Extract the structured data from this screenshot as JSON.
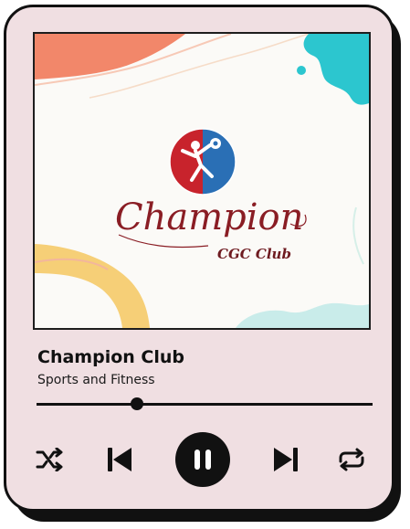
{
  "player": {
    "track_title": "Champion Club",
    "track_artist": "Sports and Fitness",
    "progress": 0.3,
    "state": "playing"
  },
  "artwork": {
    "logo_word": "Champion",
    "logo_sub": "CGC Club"
  },
  "controls": {
    "shuffle": "shuffle-icon",
    "previous": "skip-previous-icon",
    "play_pause": "pause-icon",
    "next": "skip-next-icon",
    "repeat": "repeat-icon"
  },
  "colors": {
    "card_background": "#f0dfe2",
    "outline": "#111111",
    "logo_red": "#c8232c",
    "logo_blue": "#2a6fb5",
    "accent_coral": "#f2876a",
    "accent_teal": "#2cc6cf",
    "accent_yellow": "#f6cf77",
    "accent_mint": "#c9ecea"
  }
}
